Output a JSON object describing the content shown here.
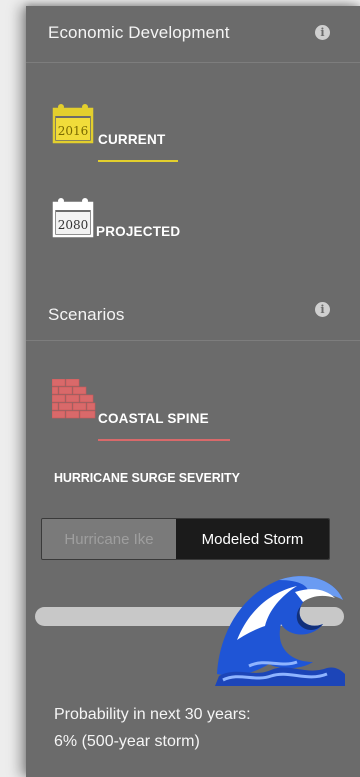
{
  "sections": {
    "economic": {
      "title": "Economic Development",
      "info_glyph": "i",
      "options": [
        {
          "year": "2016",
          "label": "CURRENT",
          "selected": true
        },
        {
          "year": "2080",
          "label": "PROJECTED",
          "selected": false
        }
      ]
    },
    "scenarios": {
      "title": "Scenarios",
      "info_glyph": "i",
      "option": {
        "label": "COASTAL SPINE",
        "icon": "brick-wall-icon",
        "selected": true
      }
    }
  },
  "surge": {
    "title": "HURRICANE SURGE SEVERITY",
    "toggle": {
      "options": [
        "Hurricane Ike",
        "Modeled Storm"
      ],
      "selected": "Modeled Storm"
    },
    "slider": {
      "handle_icon": "wave-icon",
      "level_fraction": 0.82
    },
    "probability_line1": "Probability in next 30 years:",
    "probability_line2": "6% (500-year storm)"
  },
  "colors": {
    "panel_bg": "#6b6b6b",
    "current_accent": "#e3cf2d",
    "coastal_accent": "#d9696a",
    "wave_blue": "#1f55d6"
  }
}
